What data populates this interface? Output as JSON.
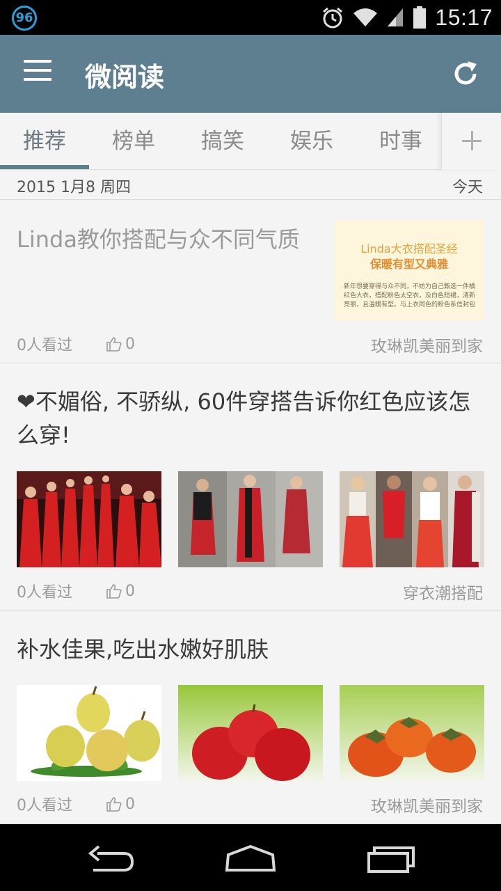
{
  "status_bar": {
    "badge": "96",
    "time": "15:17",
    "icons": [
      "alarm-icon",
      "wifi-icon",
      "signal-icon",
      "battery-icon"
    ]
  },
  "app_bar": {
    "title": "微阅读",
    "menu_icon": "menu-icon",
    "refresh_icon": "refresh-icon"
  },
  "tabs": [
    "推荐",
    "榜单",
    "搞笑",
    "娱乐",
    "时事"
  ],
  "active_tab": 0,
  "date_row": {
    "date": "2015 1月8 周四",
    "label": "今天"
  },
  "feed": [
    {
      "title": "Linda教你搭配与众不同气质",
      "views": "0人看过",
      "likes": "0",
      "source": "玫琳凯美丽到家",
      "thumb_text_1": "Linda大衣搭配圣经",
      "thumb_text_2": "保暖有型又典雅",
      "thumb_text_3": "新年想要穿得与众不同，不妨为自己甄选一件橘红色大衣，搭配粉色太空衣，及白色短裙，清新亮丽，且温暖有型。与上衣同色的粉色系信封包"
    },
    {
      "title": "❤不媚俗, 不骄纵, 60件穿搭告诉你红色应该怎么穿!",
      "views": "0人看过",
      "likes": "0",
      "source": "穿衣潮搭配"
    },
    {
      "title": "补水佳果,吃出水嫩好肌肤",
      "views": "0人看过",
      "likes": "0",
      "source": "玫琳凯美丽到家"
    }
  ],
  "colors": {
    "app_bar": "#5e7f8f",
    "background": "#f4f4f4",
    "status_badge": "#2aa0d8"
  }
}
